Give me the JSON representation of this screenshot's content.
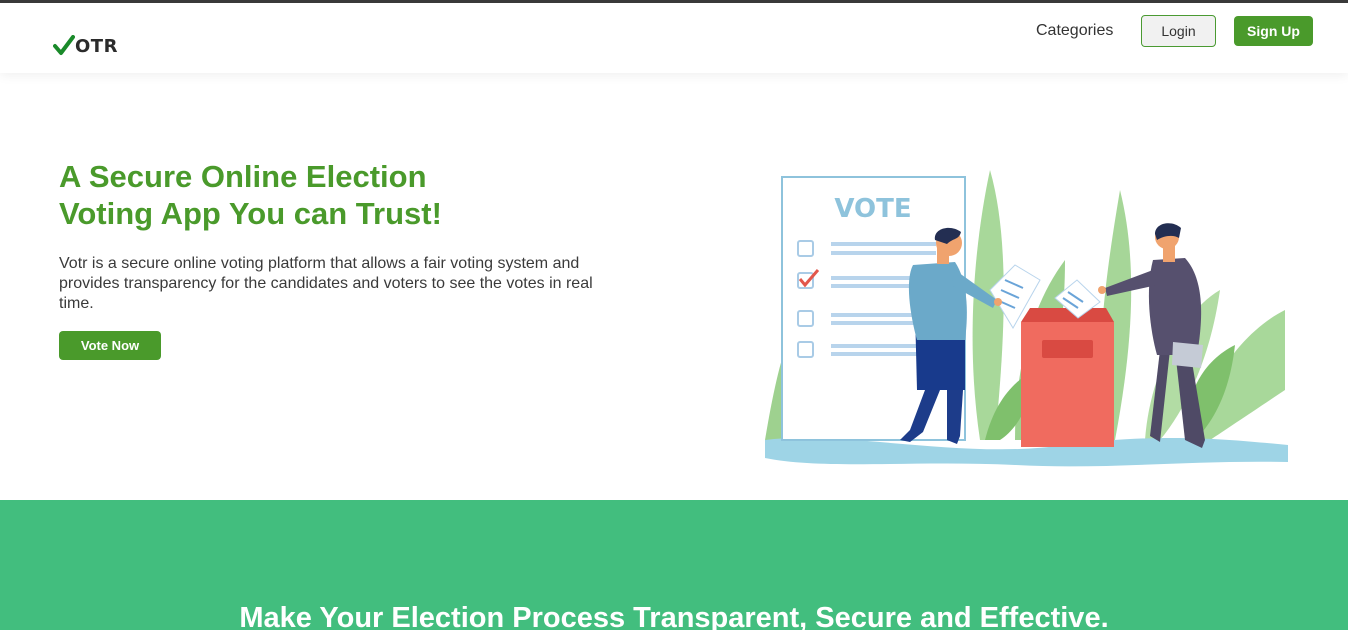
{
  "brand": {
    "logo_text": "OTR",
    "logo_icon": "checkmark-icon",
    "color": "#1a8a2a"
  },
  "nav": {
    "categories_label": "Categories",
    "login_label": "Login",
    "signup_label": "Sign Up"
  },
  "hero": {
    "title_line1": "A Secure Online Election",
    "title_line2": "Voting App You can Trust!",
    "description": "Votr is a secure online voting platform that allows a fair voting system and provides transparency for the candidates and voters to see the votes in real time.",
    "cta_label": "Vote Now",
    "illustration": {
      "ballot_header": "VOTE"
    }
  },
  "band": {
    "title": "Make Your Election Process Transparent, Secure and Effective."
  },
  "colors": {
    "accent": "#4a9a2b",
    "band": "#42be7e",
    "ballot_box": "#f06b5f"
  }
}
